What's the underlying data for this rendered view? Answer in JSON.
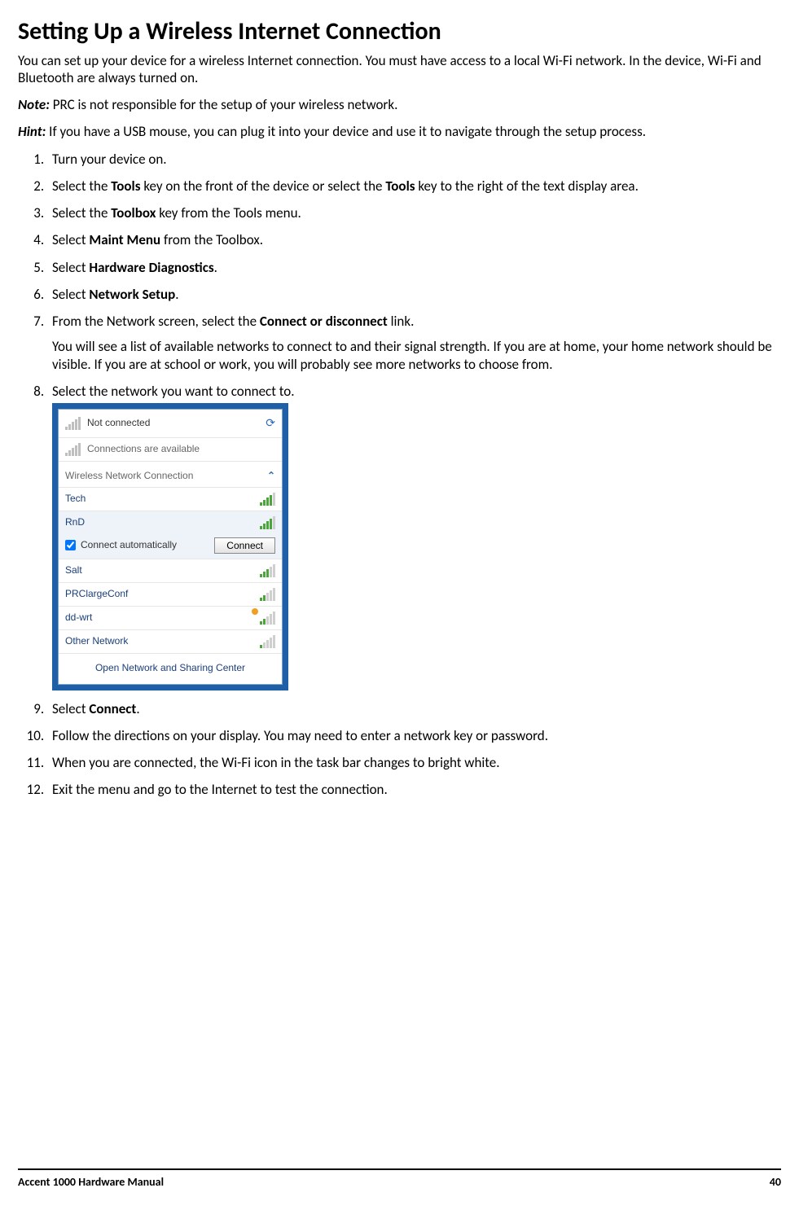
{
  "title": "Setting Up a Wireless Internet Connection",
  "intro": "You can set up your device for a wireless Internet connection. You must have access to a local Wi-Fi network. In the device, Wi-Fi and Bluetooth are always turned on.",
  "note_label": "Note:",
  "note_text": " PRC is not responsible for the setup of your wireless network.",
  "hint_label": "Hint:",
  "hint_text": " If you have a USB mouse, you can plug it into your device and use it to navigate through the setup process.",
  "steps": {
    "s1": "Turn your device on.",
    "s2a": "Select the ",
    "s2b": "Tools",
    "s2c": " key on the front of the device or select the ",
    "s2d": "Tools",
    "s2e": " key to the right of the text display area.",
    "s3a": "Select the ",
    "s3b": "Toolbox",
    "s3c": " key from the Tools menu.",
    "s4a": "Select ",
    "s4b": "Maint Menu",
    "s4c": " from the Toolbox.",
    "s5a": "Select ",
    "s5b": "Hardware Diagnostics",
    "s5c": ".",
    "s6a": "Select ",
    "s6b": "Network Setup",
    "s6c": ".",
    "s7a": "From the Network screen, select the ",
    "s7b": "Connect or disconnect",
    "s7c": " link.",
    "s7_extra": "You will see a list of available networks to connect to and their signal strength. If you are at home, your home network should be visible. If you are at school or work, you will probably see more networks to choose from.",
    "s8": "Select the network you want to connect to.",
    "s9a": "Select ",
    "s9b": "Connect",
    "s9c": ".",
    "s10": "Follow the directions on your display. You may need to enter a network key or password.",
    "s11": "When you are connected, the Wi-Fi icon in the task bar changes to bright white.",
    "s12": "Exit the menu and go to the Internet to test the connection."
  },
  "panel": {
    "status": "Not connected",
    "avail": "Connections are available",
    "section": "Wireless Network Connection",
    "auto_label": "Connect automatically",
    "connect_btn": "Connect",
    "open_center": "Open Network and Sharing Center",
    "networks": {
      "n0": "Tech",
      "n1": "RnD",
      "n2": "Salt",
      "n3": "PRClargeConf",
      "n4": "dd-wrt",
      "n5": "Other Network"
    }
  },
  "footer": {
    "left": "Accent 1000 Hardware Manual",
    "page": "40"
  }
}
